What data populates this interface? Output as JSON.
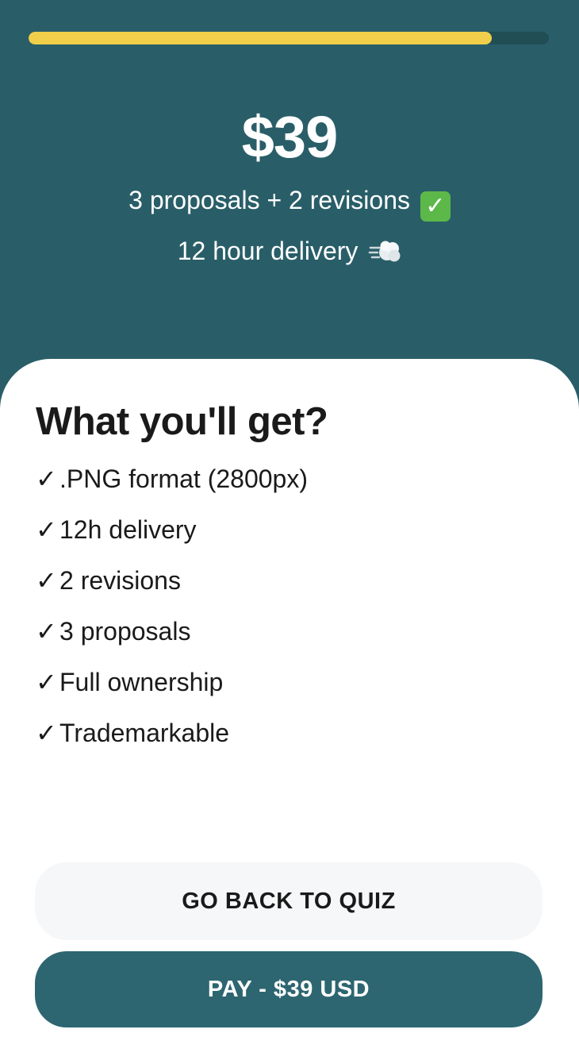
{
  "progress": {
    "fraction": 0.89
  },
  "header": {
    "price": "$39",
    "line1_text": "3 proposals + 2 revisions",
    "line1_icon": "check-mark-emoji",
    "line2_text": "12 hour delivery",
    "line2_icon": "dash-emoji"
  },
  "card": {
    "title": "What you'll get?",
    "check_symbol": "✓",
    "features": [
      ".PNG format (2800px)",
      "12h delivery",
      "2 revisions",
      "3 proposals",
      "Full ownership",
      "Trademarkable"
    ]
  },
  "buttons": {
    "back_label": "GO BACK TO QUIZ",
    "pay_label": "PAY - $39 USD"
  },
  "colors": {
    "header_bg": "#295e68",
    "progress_fill": "#f1cf4a",
    "pay_button": "#2d6670"
  }
}
